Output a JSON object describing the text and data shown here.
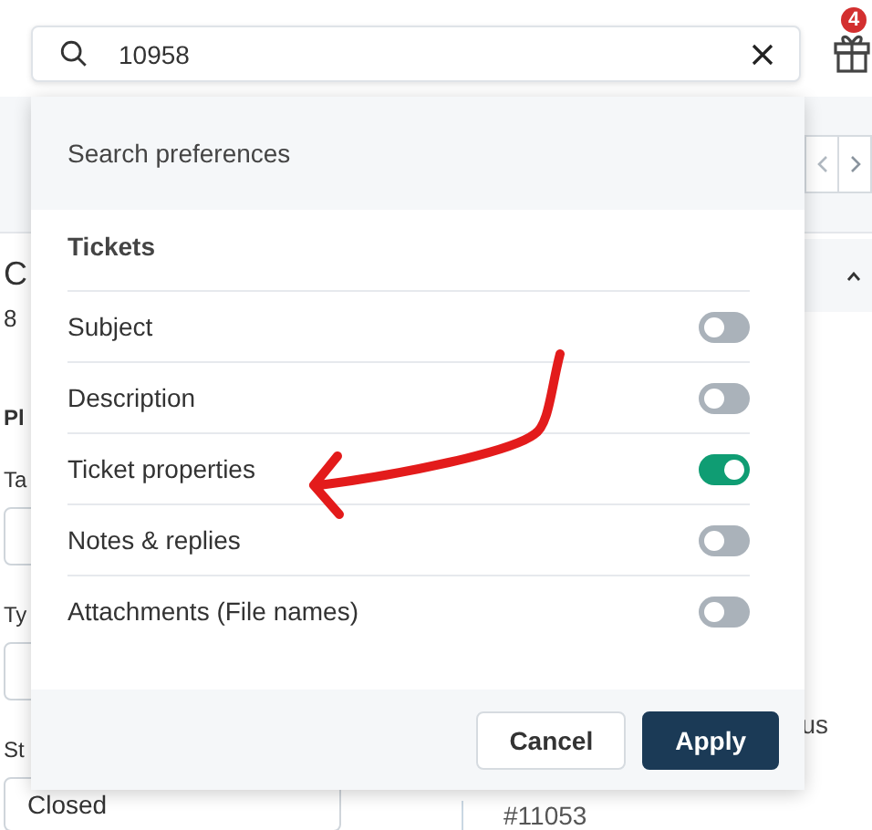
{
  "search": {
    "value": "10958"
  },
  "notifications": {
    "badge": "4"
  },
  "page": {
    "title_fragment": "C",
    "count_fragment": "8",
    "section_fragment": "Pl",
    "fields": [
      {
        "label_fragment": "Ta"
      },
      {
        "label_fragment": "Ty"
      }
    ],
    "status": {
      "label_fragment": "St",
      "value": "Closed"
    },
    "right_fragment": "us",
    "ticket_id": "#11053"
  },
  "popover": {
    "title": "Search preferences",
    "section": "Tickets",
    "options": [
      {
        "label": "Subject",
        "on": false
      },
      {
        "label": "Description",
        "on": false
      },
      {
        "label": "Ticket properties",
        "on": true
      },
      {
        "label": "Notes & replies",
        "on": false
      },
      {
        "label": "Attachments (File names)",
        "on": false
      }
    ],
    "buttons": [
      {
        "label": "Cancel",
        "kind": "secondary"
      },
      {
        "label": "Apply",
        "kind": "primary"
      }
    ]
  }
}
